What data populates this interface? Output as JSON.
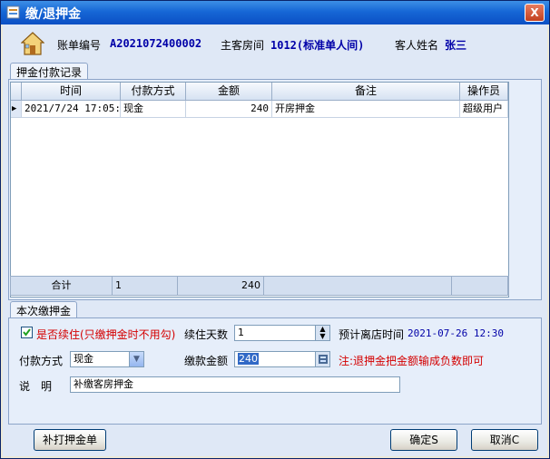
{
  "window": {
    "title": "缴/退押金",
    "close_label": "X"
  },
  "info": {
    "bill_label": "账单编号",
    "bill_value": "A2021072400002",
    "room_label": "主客房间",
    "room_value": "1012(标准单人间)",
    "guest_label": "客人姓名",
    "guest_value": "张三"
  },
  "records": {
    "tab_label": "押金付款记录",
    "columns": [
      "时间",
      "付款方式",
      "金额",
      "备注",
      "操作员"
    ],
    "rows": [
      {
        "time": "2021/7/24 17:05:",
        "method": "现金",
        "amount": "240",
        "note": "开房押金",
        "operator": "超级用户"
      }
    ],
    "row_pointer": "▶",
    "total_label": "合计",
    "total_count": "1",
    "total_amount": "240"
  },
  "deposit": {
    "tab_label": "本次缴押金",
    "continue_checkbox_label": "是否续住(只缴押金时不用勾)",
    "continue_checked": true,
    "days_label": "续住天数",
    "days_value": "1",
    "checkout_label": "预计离店时间",
    "checkout_value": "2021-07-26 12:30",
    "method_label": "付款方式",
    "method_value": "现金",
    "amount_label": "缴款金额",
    "amount_value": "240",
    "note_warning": "注:退押金把金额输成负数即可",
    "remark_label": "说　明",
    "remark_value": "补缴客房押金"
  },
  "buttons": {
    "reprint": "补打押金单",
    "ok": "确定S",
    "cancel": "取消C"
  },
  "colors": {
    "title_bar": "#1667d6",
    "value_blue": "#0000a8",
    "warning_red": "#d40000"
  }
}
